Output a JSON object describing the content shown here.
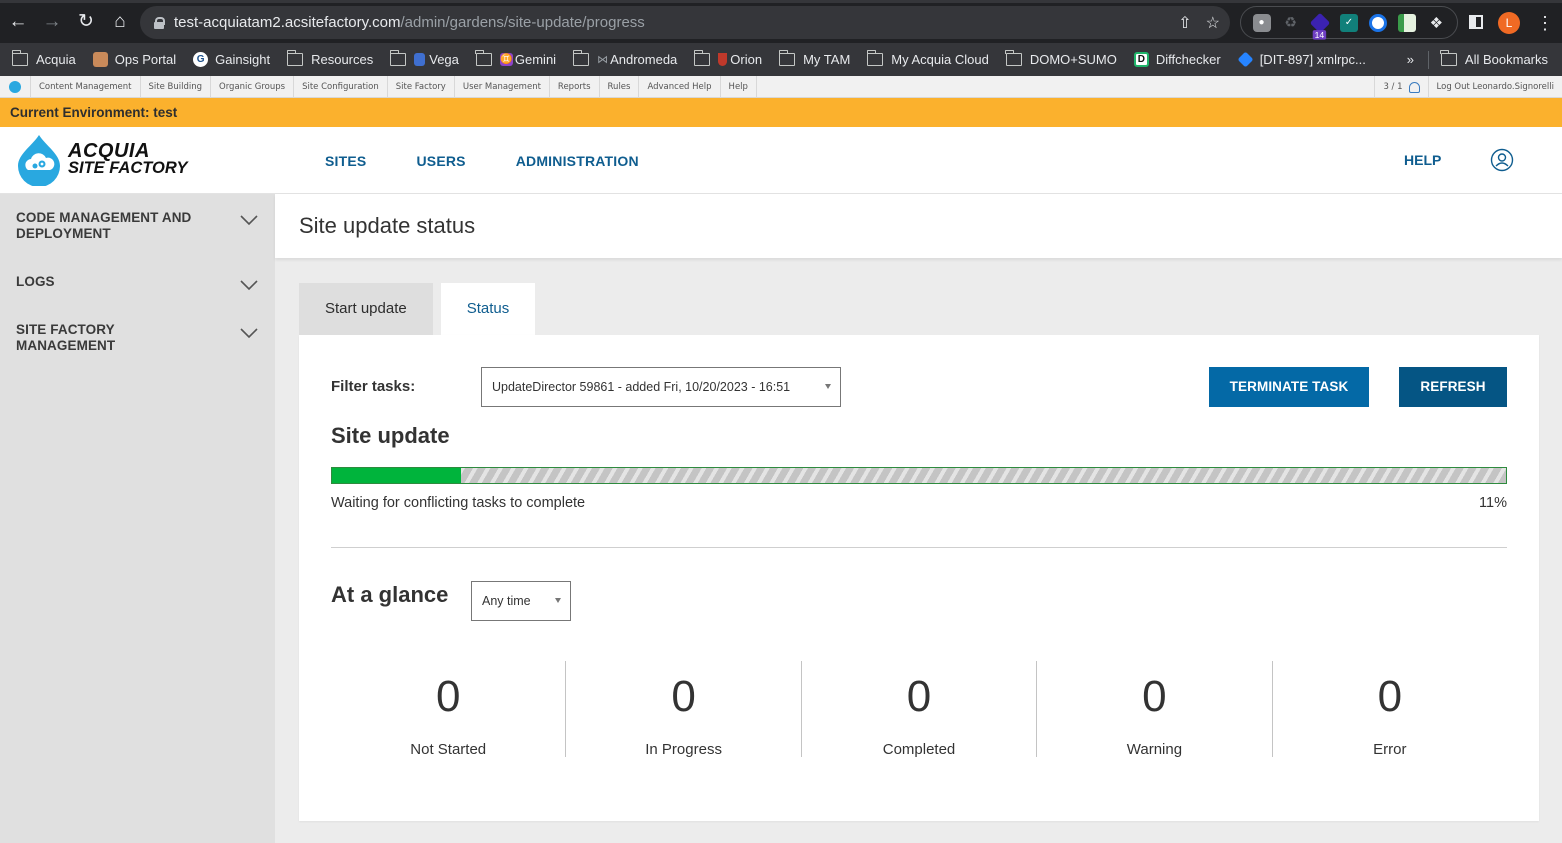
{
  "browser": {
    "url_host": "test-acquiatam2.acsitefactory.com",
    "url_path": "/admin/gardens/site-update/progress",
    "extension_badge": "14",
    "profile_initial": "L",
    "bookmarks": [
      {
        "label": "Acquia",
        "icon": "building-folder"
      },
      {
        "label": "Ops Portal",
        "icon": "favicon"
      },
      {
        "label": "Gainsight",
        "icon": "favicon"
      },
      {
        "label": "Resources",
        "icon": "folder"
      },
      {
        "label": "Vega",
        "icon": "folder"
      },
      {
        "label": "Gemini",
        "icon": "folder"
      },
      {
        "label": "Andromeda",
        "icon": "folder"
      },
      {
        "label": "Orion",
        "icon": "folder"
      },
      {
        "label": "My TAM",
        "icon": "folder"
      },
      {
        "label": "My Acquia Cloud",
        "icon": "folder"
      },
      {
        "label": "DOMO+SUMO",
        "icon": "folder"
      },
      {
        "label": "Diffchecker",
        "icon": "favicon"
      },
      {
        "label": "[DIT-897] xmlrpc...",
        "icon": "favicon"
      }
    ],
    "overflow": "»",
    "all_bookmarks": "All Bookmarks"
  },
  "admin_toolbar": {
    "items": [
      "Content Management",
      "Site Building",
      "Organic Groups",
      "Site Configuration",
      "Site Factory",
      "User Management",
      "Reports",
      "Rules",
      "Advanced Help",
      "Help"
    ],
    "user_count": "3 / 1",
    "logout": "Log Out Leonardo.Signorelli"
  },
  "environment_banner": "Current Environment: test",
  "header": {
    "logo_line1": "ACQUIA",
    "logo_line2": "SITE FACTORY",
    "nav": [
      "SITES",
      "USERS",
      "ADMINISTRATION"
    ],
    "help": "HELP"
  },
  "sidebar": {
    "items": [
      {
        "label": "CODE MANAGEMENT AND DEPLOYMENT"
      },
      {
        "label": "LOGS"
      },
      {
        "label": "SITE FACTORY MANAGEMENT"
      }
    ]
  },
  "main": {
    "title": "Site update status",
    "tabs": [
      {
        "label": "Start update",
        "active": false
      },
      {
        "label": "Status",
        "active": true
      }
    ],
    "filter_label": "Filter tasks:",
    "filter_value": "UpdateDirector 59861 - added Fri, 10/20/2023 - 16:51",
    "terminate_button": "TERMINATE TASK",
    "refresh_button": "REFRESH",
    "site_update_title": "Site update",
    "progress_percent": 11,
    "progress_label": "11%",
    "progress_message": "Waiting for conflicting tasks to complete",
    "glance_title": "At a glance",
    "time_filter": "Any time",
    "stats": [
      {
        "value": "0",
        "label": "Not Started"
      },
      {
        "value": "0",
        "label": "In Progress"
      },
      {
        "value": "0",
        "label": "Completed"
      },
      {
        "value": "0",
        "label": "Warning"
      },
      {
        "value": "0",
        "label": "Error"
      }
    ]
  },
  "colors": {
    "env_banner": "#fbb12d",
    "nav_link": "#0f5d8f",
    "terminate_button": "#0469a6",
    "refresh_button": "#055584",
    "progress_fill": "#00b43c",
    "brand_drop": "#29a8e0"
  }
}
